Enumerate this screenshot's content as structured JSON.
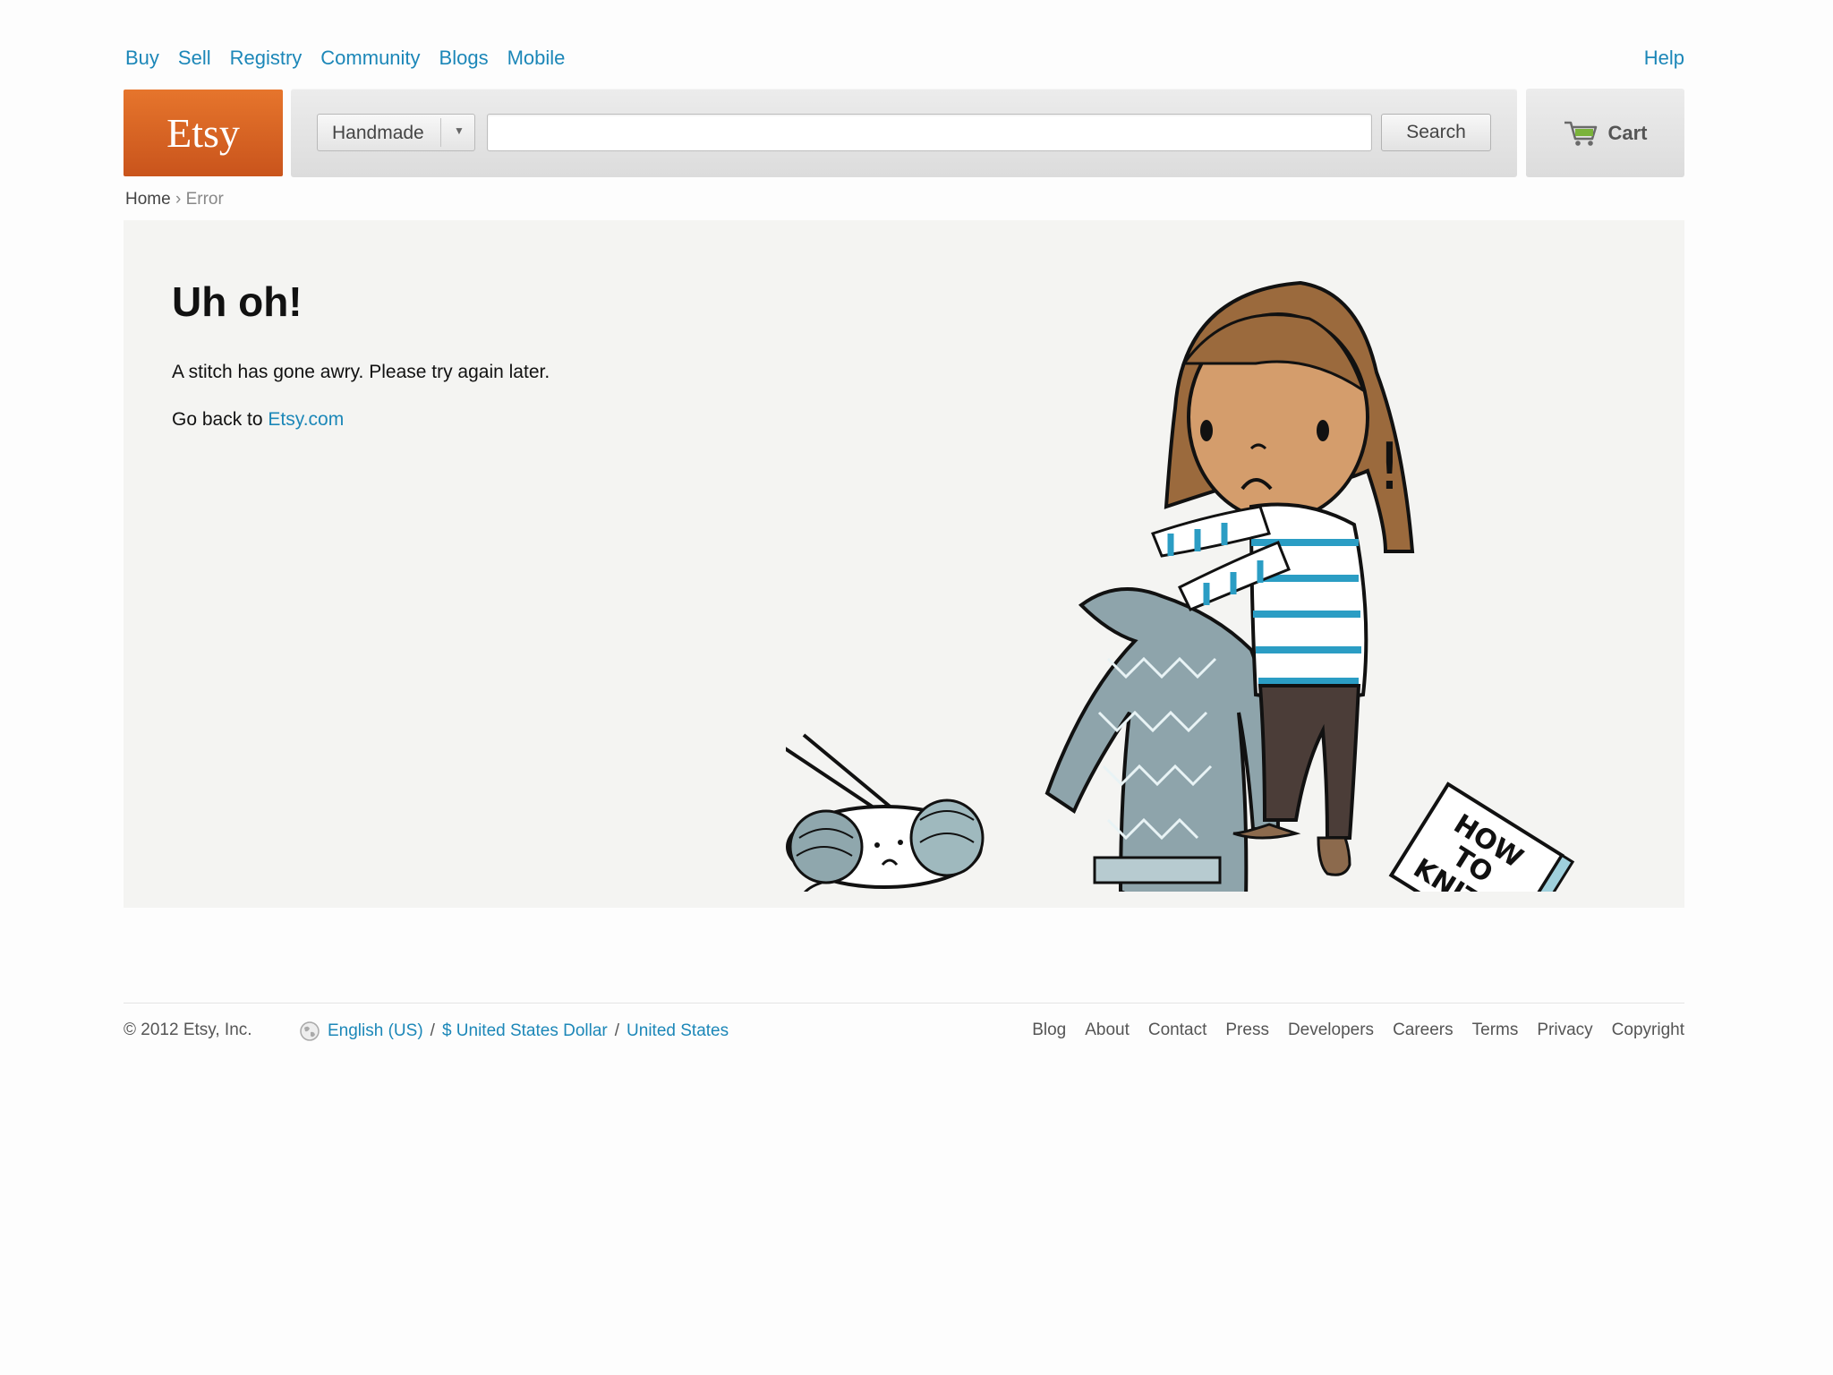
{
  "topnav": {
    "items": [
      "Buy",
      "Sell",
      "Registry",
      "Community",
      "Blogs",
      "Mobile"
    ],
    "help": "Help"
  },
  "header": {
    "logo": "Etsy",
    "category": "Handmade",
    "search_value": "",
    "search_button": "Search",
    "cart": "Cart"
  },
  "breadcrumb": {
    "home": "Home",
    "separator": "›",
    "current": "Error"
  },
  "error": {
    "title": "Uh oh!",
    "message": "A stitch has gone awry. Please try again later.",
    "back_prefix": "Go back to",
    "back_link": "Etsy.com"
  },
  "illustration_text": {
    "book": [
      "HOW",
      "TO",
      "KNIT"
    ],
    "exclaim": "!"
  },
  "footer": {
    "copyright": "© 2012 Etsy, Inc.",
    "language": "English (US)",
    "sep": "/",
    "currency": "$ United States Dollar",
    "region": "United States",
    "links": [
      "Blog",
      "About",
      "Contact",
      "Press",
      "Developers",
      "Careers",
      "Terms",
      "Privacy",
      "Copyright"
    ]
  },
  "colors": {
    "link": "#1c87b8",
    "logo": "#d2611f",
    "panel": "#f4f4f2"
  }
}
